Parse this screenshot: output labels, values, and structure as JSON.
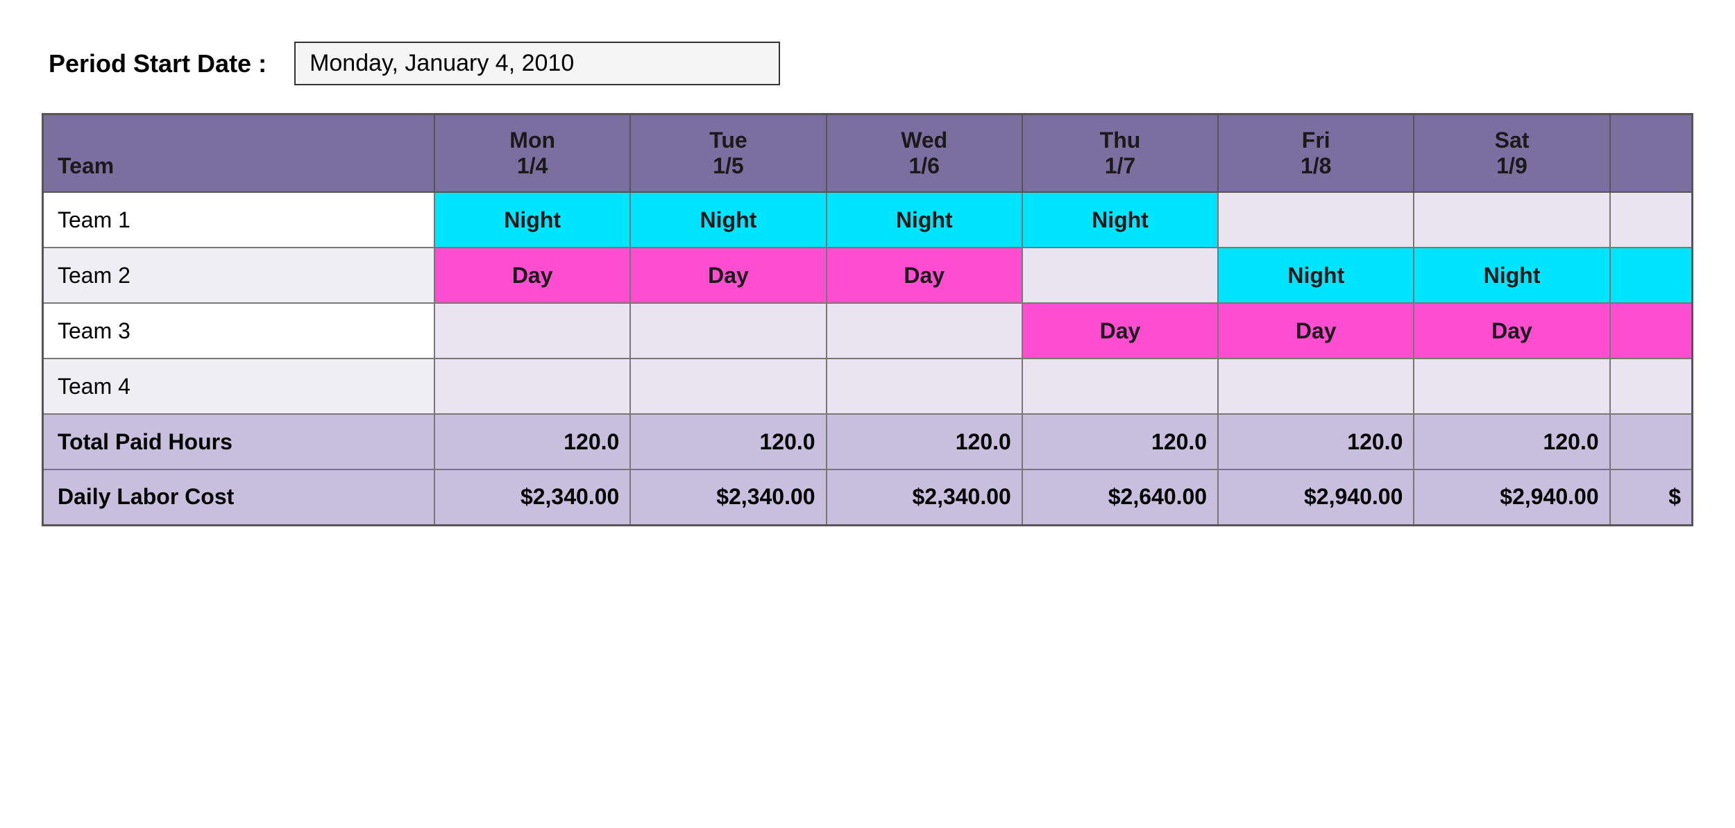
{
  "header": {
    "period_label": "Period Start Date :",
    "period_value": "Monday, January 4, 2010"
  },
  "table": {
    "columns": [
      {
        "id": "team",
        "label": "Team",
        "sub": ""
      },
      {
        "id": "mon",
        "label": "Mon",
        "sub": "1/4"
      },
      {
        "id": "tue",
        "label": "Tue",
        "sub": "1/5"
      },
      {
        "id": "wed",
        "label": "Wed",
        "sub": "1/6"
      },
      {
        "id": "thu",
        "label": "Thu",
        "sub": "1/7"
      },
      {
        "id": "fri",
        "label": "Fri",
        "sub": "1/8"
      },
      {
        "id": "sat",
        "label": "Sat",
        "sub": "1/9"
      }
    ],
    "teams": [
      {
        "name": "Team 1",
        "schedule": [
          "Night",
          "Night",
          "Night",
          "Night",
          "",
          ""
        ]
      },
      {
        "name": "Team 2",
        "schedule": [
          "Day",
          "Day",
          "Day",
          "",
          "Night",
          "Night"
        ]
      },
      {
        "name": "Team 3",
        "schedule": [
          "",
          "",
          "",
          "Day",
          "Day",
          "Day"
        ]
      },
      {
        "name": "Team 4",
        "schedule": [
          "",
          "",
          "",
          "",
          "",
          ""
        ]
      }
    ],
    "summary": {
      "total_paid_hours_label": "Total Paid Hours",
      "total_paid_hours_values": [
        "120.0",
        "120.0",
        "120.0",
        "120.0",
        "120.0",
        "120.0"
      ],
      "daily_labor_cost_label": "Daily Labor Cost",
      "daily_labor_cost_values": [
        "$2,340.00",
        "$2,340.00",
        "$2,340.00",
        "$2,640.00",
        "$2,940.00",
        "$2,940.00"
      ]
    },
    "partial_col_indicator": "$"
  }
}
